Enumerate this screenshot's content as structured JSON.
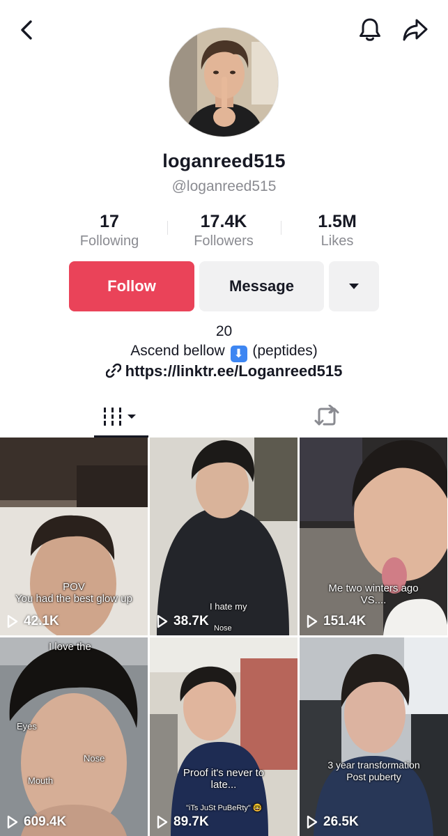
{
  "profile": {
    "display_name": "loganreed515",
    "handle": "@loganreed515",
    "avatar_icon": "avatar-photo"
  },
  "stats": [
    {
      "value": "17",
      "label": "Following"
    },
    {
      "value": "17.4K",
      "label": "Followers"
    },
    {
      "value": "1.5M",
      "label": "Likes"
    }
  ],
  "actions": {
    "follow_label": "Follow",
    "message_label": "Message",
    "more_icon": "caret-down-icon"
  },
  "bio": {
    "line1": "20",
    "line2_before": "Ascend bellow",
    "line2_emoji": "⬇",
    "line2_after": "(peptides)",
    "link": "https://linktr.ee/Loganreed515"
  },
  "tabs": {
    "videos_icon": "grid-videos-icon",
    "reposts_icon": "repost-icon"
  },
  "colors": {
    "follow": "#ea4359",
    "secondary_button": "#f1f1f2",
    "muted_text": "#8a8b91"
  },
  "videos": [
    {
      "views": "42.1K",
      "caption": "POV\nYou had the best glow up"
    },
    {
      "views": "38.7K",
      "caption": "I hate my",
      "caption2": "Nose"
    },
    {
      "views": "151.4K",
      "caption": "Me two winters ago\nVS...."
    },
    {
      "views": "609.4K",
      "caption": "I love the",
      "caption2": "Eyes",
      "caption3": "Nose",
      "caption4": "Mouth"
    },
    {
      "views": "89.7K",
      "caption": "Proof it's never to\nlate...",
      "caption2": "\"iTs JuSt PuBeRty\" 🤓"
    },
    {
      "views": "26.5K",
      "caption": "3 year transformation\nPost puberty"
    }
  ]
}
